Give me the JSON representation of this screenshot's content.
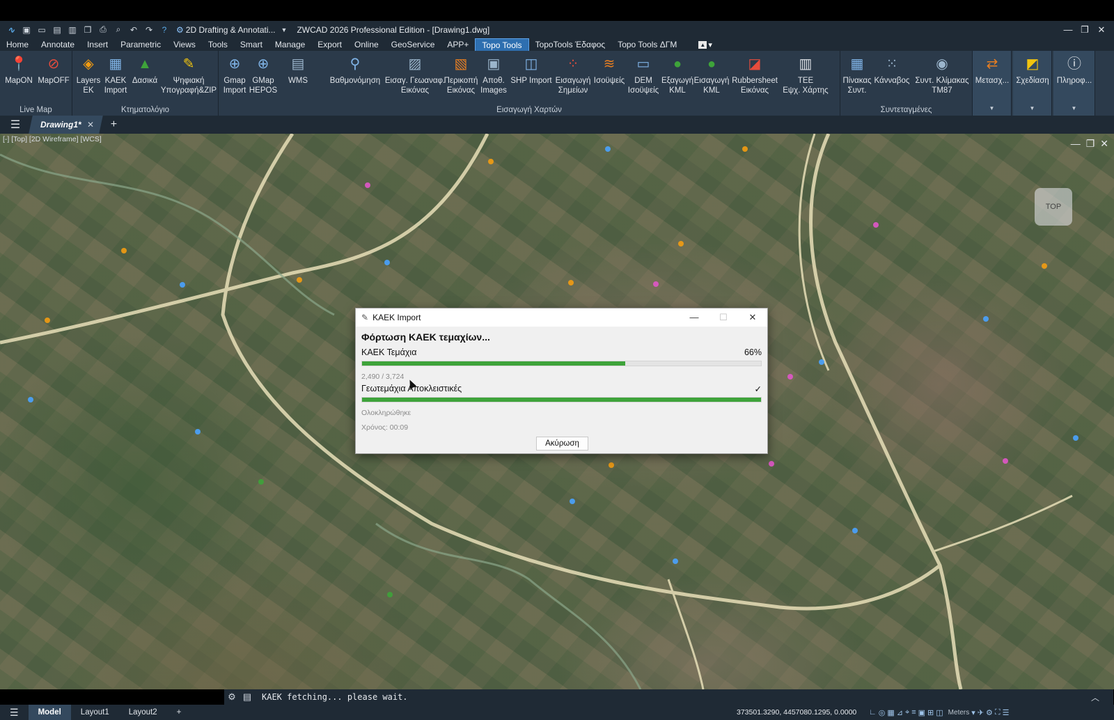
{
  "window": {
    "workspace": "2D Drafting & Annotati...",
    "title": "ZWCAD 2026 Professional Edition - [Drawing1.dwg]",
    "controls": [
      "—",
      "❐",
      "✕"
    ]
  },
  "menu": [
    "Home",
    "Annotate",
    "Insert",
    "Parametric",
    "Views",
    "Tools",
    "Smart",
    "Manage",
    "Export",
    "Online",
    "GeoService",
    "APP+",
    "Topo Tools",
    "TopoTools Έδαφος",
    "Topo Tools ΔΓΜ"
  ],
  "menu_active": "Topo Tools",
  "ribbon": {
    "panels": {
      "live_map": "Live Map",
      "ktimatologio": "Κτηματολόγιο",
      "eisagogi": "Εισαγωγή Χαρτών",
      "syntetagmenes": "Συντεταγμένες"
    },
    "buttons": [
      {
        "l1": "MapON",
        "l2": "",
        "icon": "map-on-icon"
      },
      {
        "l1": "MapOFF",
        "l2": "",
        "icon": "map-off-icon"
      },
      {
        "l1": "Layers",
        "l2": "ΕΚ",
        "icon": "layers-icon"
      },
      {
        "l1": "KAEK",
        "l2": "Import",
        "icon": "kaek-import-icon"
      },
      {
        "l1": "Δασικά",
        "l2": "",
        "icon": "forest-icon"
      },
      {
        "l1": "Ψηφιακή",
        "l2": "Υπογραφή&ZIP",
        "icon": "signature-icon"
      },
      {
        "l1": "Gmap",
        "l2": "Import",
        "icon": "globe-icon"
      },
      {
        "l1": "GMap",
        "l2": "HEPOS",
        "icon": "globe-hepos-icon"
      },
      {
        "l1": "WMS",
        "l2": "",
        "icon": "wms-icon"
      },
      {
        "l1": "Βαθμονόμηση",
        "l2": "",
        "icon": "calibrate-icon"
      },
      {
        "l1": "Εισαγ. Γεωαναφ.",
        "l2": "Εικόνας",
        "icon": "georef-image-icon"
      },
      {
        "l1": "Περικοπή",
        "l2": "Εικόνας",
        "icon": "crop-image-icon"
      },
      {
        "l1": "Αποθ.",
        "l2": "Images",
        "icon": "save-images-icon"
      },
      {
        "l1": "SHP Import",
        "l2": "",
        "icon": "shp-import-icon"
      },
      {
        "l1": "Εισαγωγή",
        "l2": "Σημείων",
        "icon": "import-points-icon"
      },
      {
        "l1": "Ισοϋψείς",
        "l2": "",
        "icon": "contours-icon"
      },
      {
        "l1": "DEM",
        "l2": "Ισοϋψείς",
        "icon": "dem-icon"
      },
      {
        "l1": "Εξαγωγή",
        "l2": "KML",
        "icon": "export-kml-icon"
      },
      {
        "l1": "Εισαγωγή",
        "l2": "KML",
        "icon": "import-kml-icon"
      },
      {
        "l1": "Rubbersheet",
        "l2": "Εικόνας",
        "icon": "rubbersheet-icon"
      },
      {
        "l1": "TEE",
        "l2": "Εψχ. Χάρτης",
        "icon": "tee-map-icon"
      },
      {
        "l1": "Πίνακας",
        "l2": "Συντ.",
        "icon": "table-icon"
      },
      {
        "l1": "Κάνναβος",
        "l2": "",
        "icon": "grid-icon"
      },
      {
        "l1": "Συντ. Κλίμακας",
        "l2": "TM87",
        "icon": "scale-icon"
      },
      {
        "l1": "Μετασχ...",
        "l2": "",
        "icon": "transform-icon"
      },
      {
        "l1": "Σχεδίαση",
        "l2": "",
        "icon": "draw-icon"
      },
      {
        "l1": "Πληροφ...",
        "l2": "",
        "icon": "info-icon"
      }
    ]
  },
  "doc_tab": "Drawing1*",
  "viewport_label": "[-] [Top] [2D Wireframe] [WCS]",
  "viewcube": "TOP",
  "dialog": {
    "title": "KAEK Import",
    "heading": "Φόρτωση ΚΑΕΚ τεμαχίων...",
    "progress1": {
      "label": "ΚΑΕΚ Τεμάχια",
      "percent_text": "66%",
      "fraction": 0.66,
      "count": "2,490 / 3,724"
    },
    "progress2": {
      "label": "Γεωτεμάχια Αποκλειστικές",
      "check": "✓",
      "fraction": 1.0,
      "status": "Ολοκληρώθηκε"
    },
    "time": "Χρόνος: 00:09",
    "cancel": "Ακύρωση",
    "controls": [
      "—",
      "☐",
      "✕"
    ]
  },
  "command_line": "KAEK fetching... please wait.",
  "status": {
    "tabs": [
      "Model",
      "Layout1",
      "Layout2"
    ],
    "coords": "373501.3290, 4457080.1295, 0.0000",
    "units": "Meters"
  }
}
